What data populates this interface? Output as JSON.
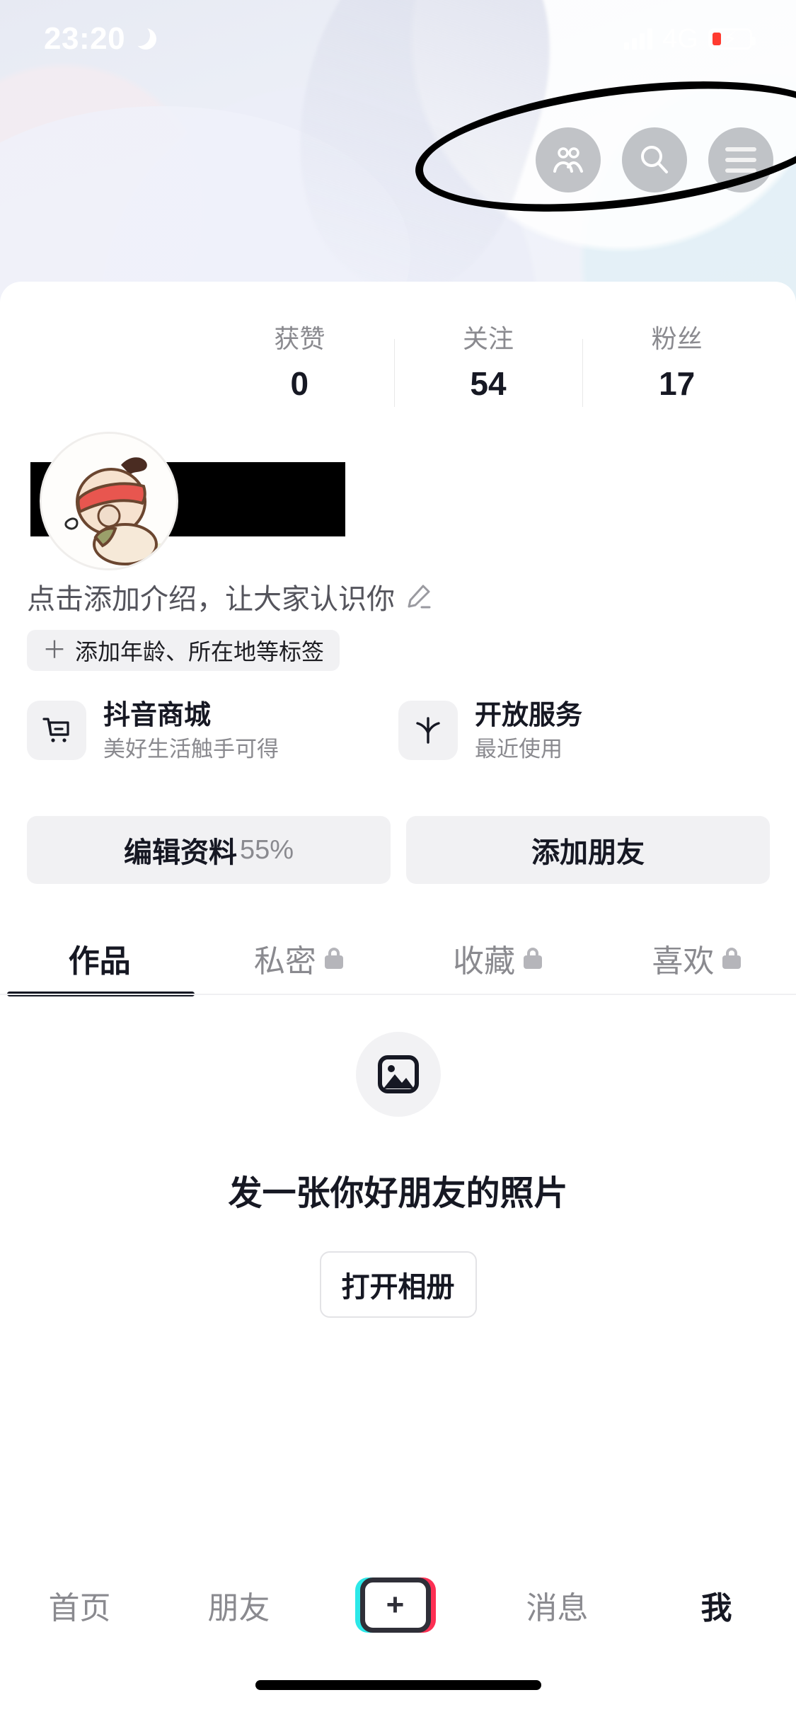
{
  "status_bar": {
    "time": "23:20",
    "moon_icon": "crescent-moon-icon",
    "signal_icon": "cellular-signal-icon",
    "network": "4G",
    "battery_icon": "battery-charging-icon"
  },
  "header": {
    "actions": [
      {
        "name": "friends-icon",
        "label": "好友"
      },
      {
        "name": "search-icon",
        "label": "搜索"
      },
      {
        "name": "menu-icon",
        "label": "菜单"
      }
    ],
    "annotation": "hand-drawn-circle-highlight"
  },
  "profile": {
    "avatar_icon": "cartoon-baby-avatar",
    "name_redacted": true,
    "stats": [
      {
        "label": "获赞",
        "value": "0"
      },
      {
        "label": "关注",
        "value": "54"
      },
      {
        "label": "粉丝",
        "value": "17"
      }
    ],
    "bio_placeholder": "点击添加介绍，让大家认识你",
    "bio_edit_icon": "pencil-icon",
    "tag_button": {
      "plus": "＋",
      "label": "添加年龄、所在地等标签"
    }
  },
  "services": [
    {
      "icon": "shopping-cart-icon",
      "title": "抖音商城",
      "subtitle": "美好生活触手可得"
    },
    {
      "icon": "douyin-service-icon",
      "title": "开放服务",
      "subtitle": "最近使用"
    }
  ],
  "actions": {
    "edit_profile_label": "编辑资料",
    "edit_profile_percent": "55%",
    "add_friend_label": "添加朋友"
  },
  "tabs": [
    {
      "label": "作品",
      "locked": false,
      "active": true
    },
    {
      "label": "私密",
      "locked": true,
      "active": false
    },
    {
      "label": "收藏",
      "locked": true,
      "active": false
    },
    {
      "label": "喜欢",
      "locked": true,
      "active": false
    }
  ],
  "empty_state": {
    "icon": "image-placeholder-icon",
    "title": "发一张你好朋友的照片",
    "button_label": "打开相册"
  },
  "bottom_nav": [
    {
      "label": "首页",
      "active": false
    },
    {
      "label": "朋友",
      "active": false
    },
    {
      "label": "+",
      "active": false,
      "is_create": true
    },
    {
      "label": "消息",
      "active": false
    },
    {
      "label": "我",
      "active": true
    }
  ],
  "colors": {
    "accent_cyan": "#2ce8e8",
    "accent_red": "#fd2f53",
    "text_primary": "#161823",
    "text_secondary": "#8a8a8f",
    "chip_bg": "#f1f1f3",
    "battery_low": "#ff3b30"
  }
}
